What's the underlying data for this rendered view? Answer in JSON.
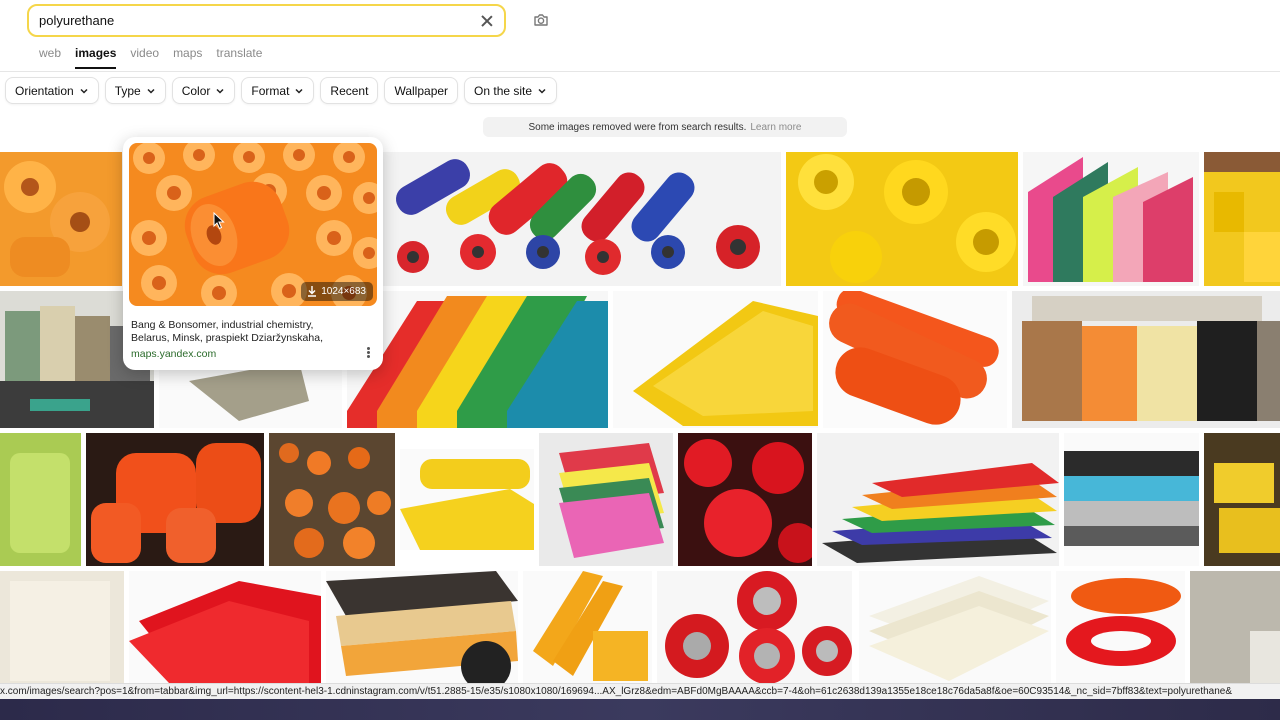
{
  "search": {
    "query": "polyurethane"
  },
  "tabs": [
    {
      "label": "web"
    },
    {
      "label": "images"
    },
    {
      "label": "video"
    },
    {
      "label": "maps"
    },
    {
      "label": "translate"
    }
  ],
  "filters": [
    {
      "label": "Orientation",
      "dropdown": true
    },
    {
      "label": "Type",
      "dropdown": true
    },
    {
      "label": "Color",
      "dropdown": true
    },
    {
      "label": "Format",
      "dropdown": true
    },
    {
      "label": "Recent",
      "dropdown": false
    },
    {
      "label": "Wallpaper",
      "dropdown": false
    },
    {
      "label": "On the site",
      "dropdown": true
    }
  ],
  "notice": {
    "text": "Some images removed were from search results.",
    "link": "Learn more"
  },
  "hover_card": {
    "size": "1024×683",
    "description": "Bang & Bonsomer, industrial chemistry, Belarus, Minsk, praspiekt Dziaržynskaha,",
    "source": "maps.yandex.com"
  },
  "status_url": "x.com/images/search?pos=1&from=tabbar&img_url=https://scontent-hel3-1.cdninstagram.com/v/t51.2885-15/e35/s1080x1080/169694...AX_lGrz8&edm=ABFd0MgBAAAA&ccb=7-4&oh=61c2638d139a1355e18ce18c76da5a8f&oe=60C93514&_nc_sid=7bff83&text=polyurethane&"
}
